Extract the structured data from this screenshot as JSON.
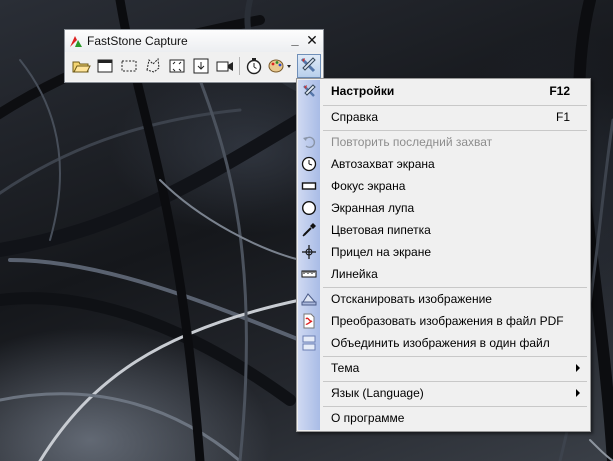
{
  "window": {
    "title": "FastStone Capture",
    "minimize_glyph": "_",
    "close_glyph": "✕"
  },
  "toolbar": [
    {
      "name": "open-icon"
    },
    {
      "name": "capture-window-icon"
    },
    {
      "name": "capture-rectangle-icon"
    },
    {
      "name": "capture-freehand-icon"
    },
    {
      "name": "capture-fullscreen-icon"
    },
    {
      "name": "capture-scrolling-icon"
    },
    {
      "name": "screen-recorder-icon"
    },
    {
      "name": "delay-timer-icon"
    },
    {
      "name": "output-palette-icon"
    },
    {
      "name": "settings-menu-icon"
    }
  ],
  "menu": {
    "settings": {
      "label": "Настройки",
      "shortcut": "F12"
    },
    "help": {
      "label": "Справка",
      "shortcut": "F1"
    },
    "repeat_last": {
      "label": "Повторить последний захват"
    },
    "auto_capture": {
      "label": "Автозахват экрана"
    },
    "screen_focus": {
      "label": "Фокус экрана"
    },
    "magnifier": {
      "label": "Экранная лупа"
    },
    "color_picker": {
      "label": "Цветовая пипетка"
    },
    "crosshair": {
      "label": "Прицел на экране"
    },
    "ruler": {
      "label": "Линейка"
    },
    "scan_image": {
      "label": "Отсканировать изображение"
    },
    "convert_pdf": {
      "label": "Преобразовать изображения в файл PDF"
    },
    "merge_images": {
      "label": "Объединить изображения в один файл"
    },
    "theme": {
      "label": "Тема"
    },
    "language": {
      "label": "Язык (Language)"
    },
    "about": {
      "label": "О программе"
    }
  },
  "colors": {
    "menu_background": "#f0f0f0",
    "gutter": "#b8c8ec",
    "disabled_text": "#8d8d8d"
  }
}
